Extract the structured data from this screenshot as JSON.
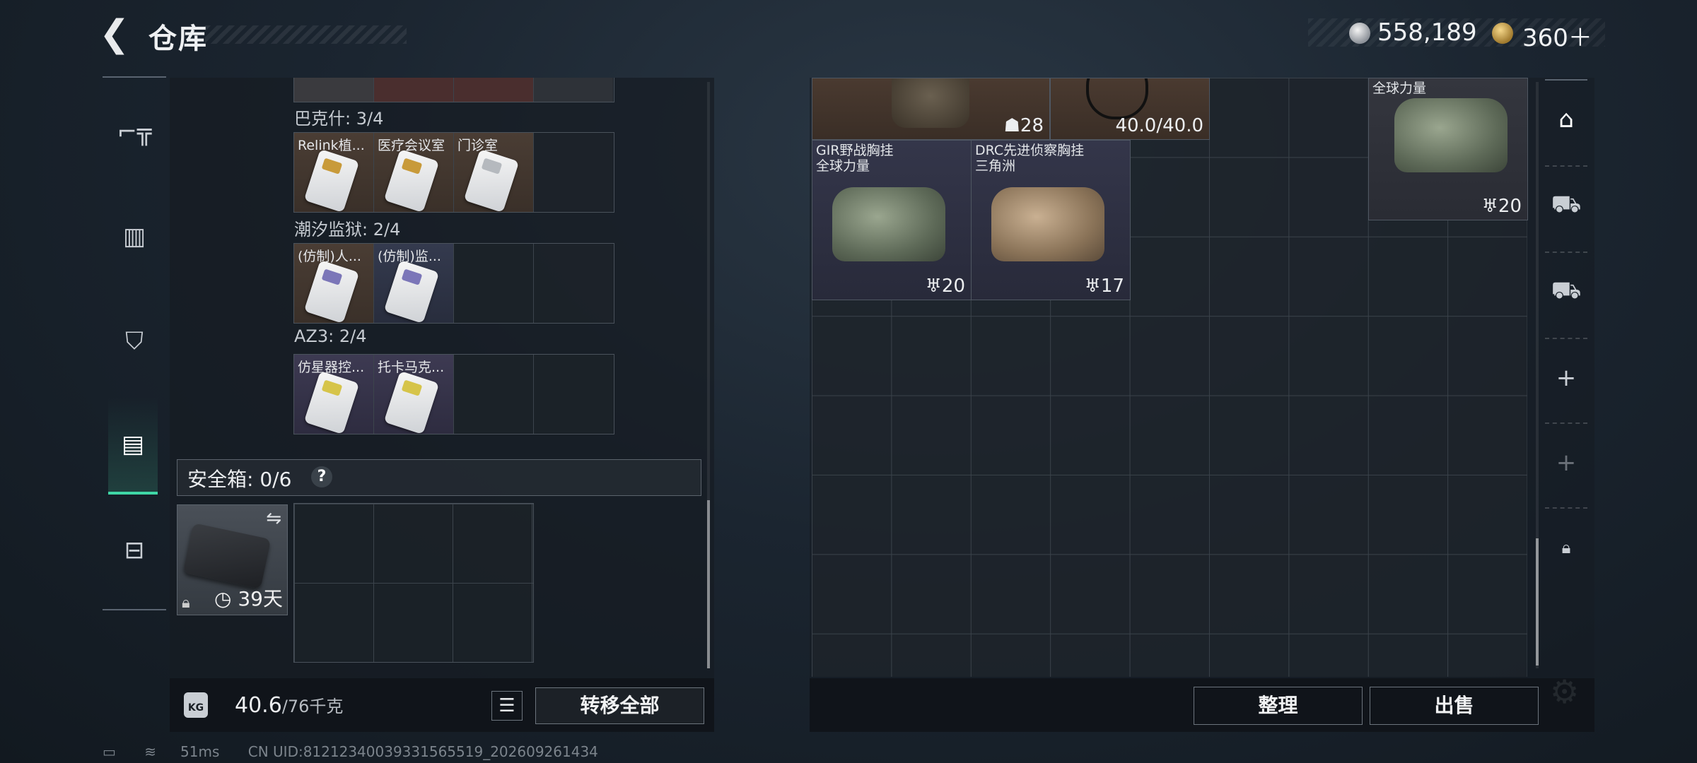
{
  "header": {
    "back_icon": "back-arrow-icon",
    "title": "仓库",
    "currency_silver": "558,189",
    "currency_gold": "360＋"
  },
  "left_rail": {
    "items": [
      {
        "icon": "gun-icon",
        "active": false
      },
      {
        "icon": "vest-icon",
        "active": false
      },
      {
        "icon": "backpack-icon",
        "active": false
      },
      {
        "icon": "container-icon",
        "active": true
      },
      {
        "icon": "toolbox-icon",
        "active": false
      }
    ]
  },
  "key_groups": [
    {
      "label": "巴克什: 3/4",
      "cells": [
        {
          "name": "Relink植...",
          "color": "brown"
        },
        {
          "name": "医疗会议室",
          "color": "brown"
        },
        {
          "name": "门诊室",
          "color": "brown"
        },
        {
          "name": "",
          "color": "empty"
        }
      ]
    },
    {
      "label": "潮汐监狱: 2/4",
      "cells": [
        {
          "name": "(仿制)人...",
          "color": "brown"
        },
        {
          "name": "(仿制)监...",
          "color": "blue"
        },
        {
          "name": "",
          "color": "empty"
        },
        {
          "name": "",
          "color": "empty"
        }
      ]
    },
    {
      "label": "AZ3: 2/4",
      "cells": [
        {
          "name": "仿星器控...",
          "color": "purple"
        },
        {
          "name": "托卡马克...",
          "color": "purple"
        },
        {
          "name": "",
          "color": "empty"
        },
        {
          "name": "",
          "color": "empty"
        }
      ]
    }
  ],
  "safe_box": {
    "label": "安全箱: 0/6",
    "help": "?",
    "timer": "39天",
    "swap_icon": "swap-icon",
    "lock_icon": "lock-icon"
  },
  "left_footer": {
    "kg_label": "KG",
    "weight_current": "40.6",
    "weight_max": "/76千克",
    "transfer_label": "转移全部"
  },
  "storage": {
    "top_row_cap_1": "28",
    "top_row_cap_2": "40.0/40.0",
    "corner_item_name": "全球力量",
    "corner_item_cap": "20",
    "items": [
      {
        "name_line1": "GIR野战胸挂",
        "name_line2": "全球力量",
        "capacity": "20",
        "color": "green"
      },
      {
        "name_line1": "DRC先进侦察胸挂",
        "name_line2": "三角洲",
        "capacity": "17",
        "color": "tan"
      }
    ]
  },
  "right_rail": {
    "items": [
      {
        "icon": "helmet-icon"
      },
      {
        "icon": "slot-iii-icon"
      },
      {
        "icon": "slot-iv-icon"
      },
      {
        "icon": "plus-icon",
        "text": "+"
      },
      {
        "icon": "plus-dim-icon",
        "text": "+"
      },
      {
        "icon": "lock-icon"
      }
    ]
  },
  "right_footer": {
    "sort_label": "整理",
    "sell_label": "出售"
  },
  "status": {
    "ping": "51ms",
    "uid": "CN UID:81212340039331565519_202609261434"
  }
}
